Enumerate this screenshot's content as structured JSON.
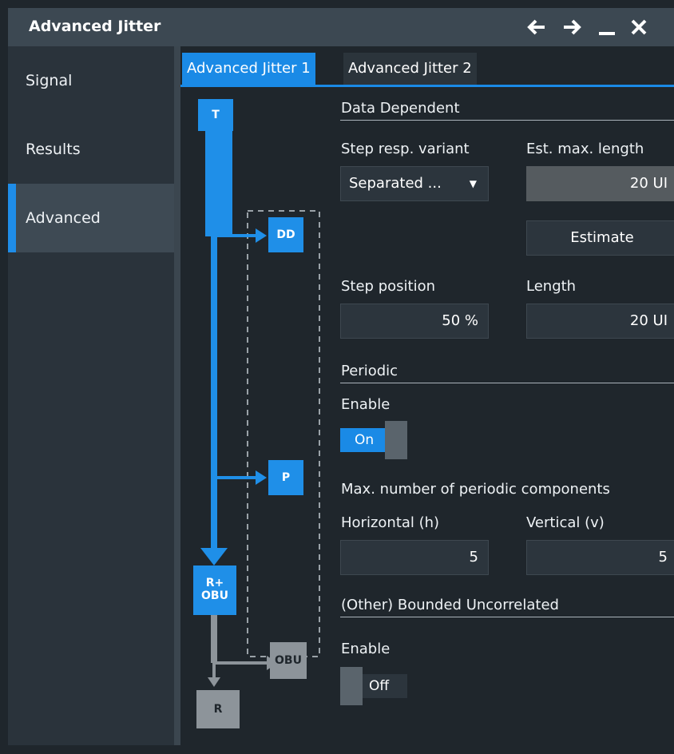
{
  "window": {
    "title": "Advanced Jitter"
  },
  "titlebar_icons": [
    "back-arrow-icon",
    "forward-arrow-icon",
    "minimize-icon",
    "close-icon"
  ],
  "sidebar": {
    "items": [
      {
        "label": "Signal",
        "active": false
      },
      {
        "label": "Results",
        "active": false
      },
      {
        "label": "Advanced",
        "active": true
      }
    ]
  },
  "tabs": [
    {
      "label": "Advanced Jitter 1",
      "active": true
    },
    {
      "label": "Advanced Jitter 2",
      "active": false
    }
  ],
  "diagram": {
    "t": "T",
    "dd": "DD",
    "p": "P",
    "r_obu": "R+\nOBU",
    "obu": "OBU",
    "r": "R"
  },
  "data_dependent": {
    "header": "Data Dependent",
    "step_resp_label": "Step resp. variant",
    "step_resp_value": "Separated ...",
    "est_max_length_label": "Est. max. length",
    "est_max_length_value": "20 UI",
    "estimate_button": "Estimate",
    "step_position_label": "Step position",
    "step_position_value": "50 %",
    "length_label": "Length",
    "length_value": "20 UI"
  },
  "periodic": {
    "header": "Periodic",
    "enable_label": "Enable",
    "enable_state": "On",
    "max_components_label": "Max. number of periodic components",
    "horizontal_label": "Horizontal (h)",
    "horizontal_value": "5",
    "vertical_label": "Vertical (v)",
    "vertical_value": "5"
  },
  "bounded_uncorrelated": {
    "header": "(Other) Bounded Uncorrelated",
    "enable_label": "Enable",
    "enable_state": "Off"
  },
  "colors": {
    "accent": "#1a8ae6",
    "diagram_blue": "#1f8fe8",
    "diagram_grey": "#8d949a",
    "background": "#1f262c"
  }
}
